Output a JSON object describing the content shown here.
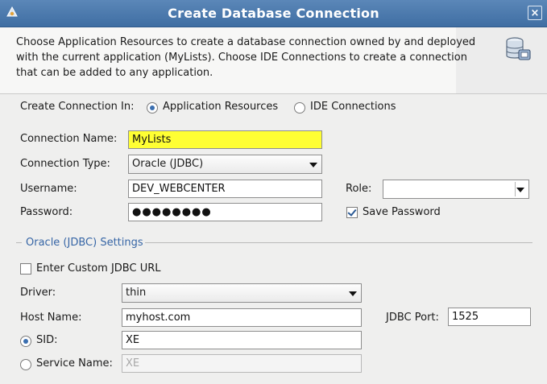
{
  "window": {
    "title": "Create Database Connection",
    "close_glyph": "×"
  },
  "icons": {
    "app": "oracle-icon",
    "close": "close-icon",
    "database": "database-connection-icon"
  },
  "banner": {
    "description": "Choose Application Resources to create a database connection owned by and deployed with the current application (MyLists). Choose IDE Connections to create a connection that can be added to any application."
  },
  "create_in": {
    "label": "Create Connection In:",
    "options": [
      "Application Resources",
      "IDE Connections"
    ],
    "selected": "Application Resources"
  },
  "connection_name": {
    "label": "Connection Name:",
    "value": "MyLists"
  },
  "connection_type": {
    "label": "Connection Type:",
    "value": "Oracle (JDBC)"
  },
  "username": {
    "label": "Username:",
    "value": "DEV_WEBCENTER"
  },
  "password": {
    "label": "Password:",
    "value": "●●●●●●●●"
  },
  "role": {
    "label": "Role:",
    "value": ""
  },
  "save_password": {
    "label": "Save Password",
    "checked": true
  },
  "jdbc_settings": {
    "title": "Oracle (JDBC) Settings",
    "custom_url": {
      "label": "Enter Custom JDBC URL",
      "checked": false
    },
    "driver": {
      "label": "Driver:",
      "value": "thin"
    },
    "host": {
      "label": "Host Name:",
      "value": "myhost.com"
    },
    "port": {
      "label": "JDBC Port:",
      "value": "1525"
    },
    "sid": {
      "label": "SID:",
      "value": "XE",
      "selected": true
    },
    "service": {
      "label": "Service Name:",
      "value": "XE",
      "selected": false
    }
  },
  "colors": {
    "titlebar": "#4a78ad",
    "highlight": "#ffff33",
    "section": "#3766a6"
  }
}
